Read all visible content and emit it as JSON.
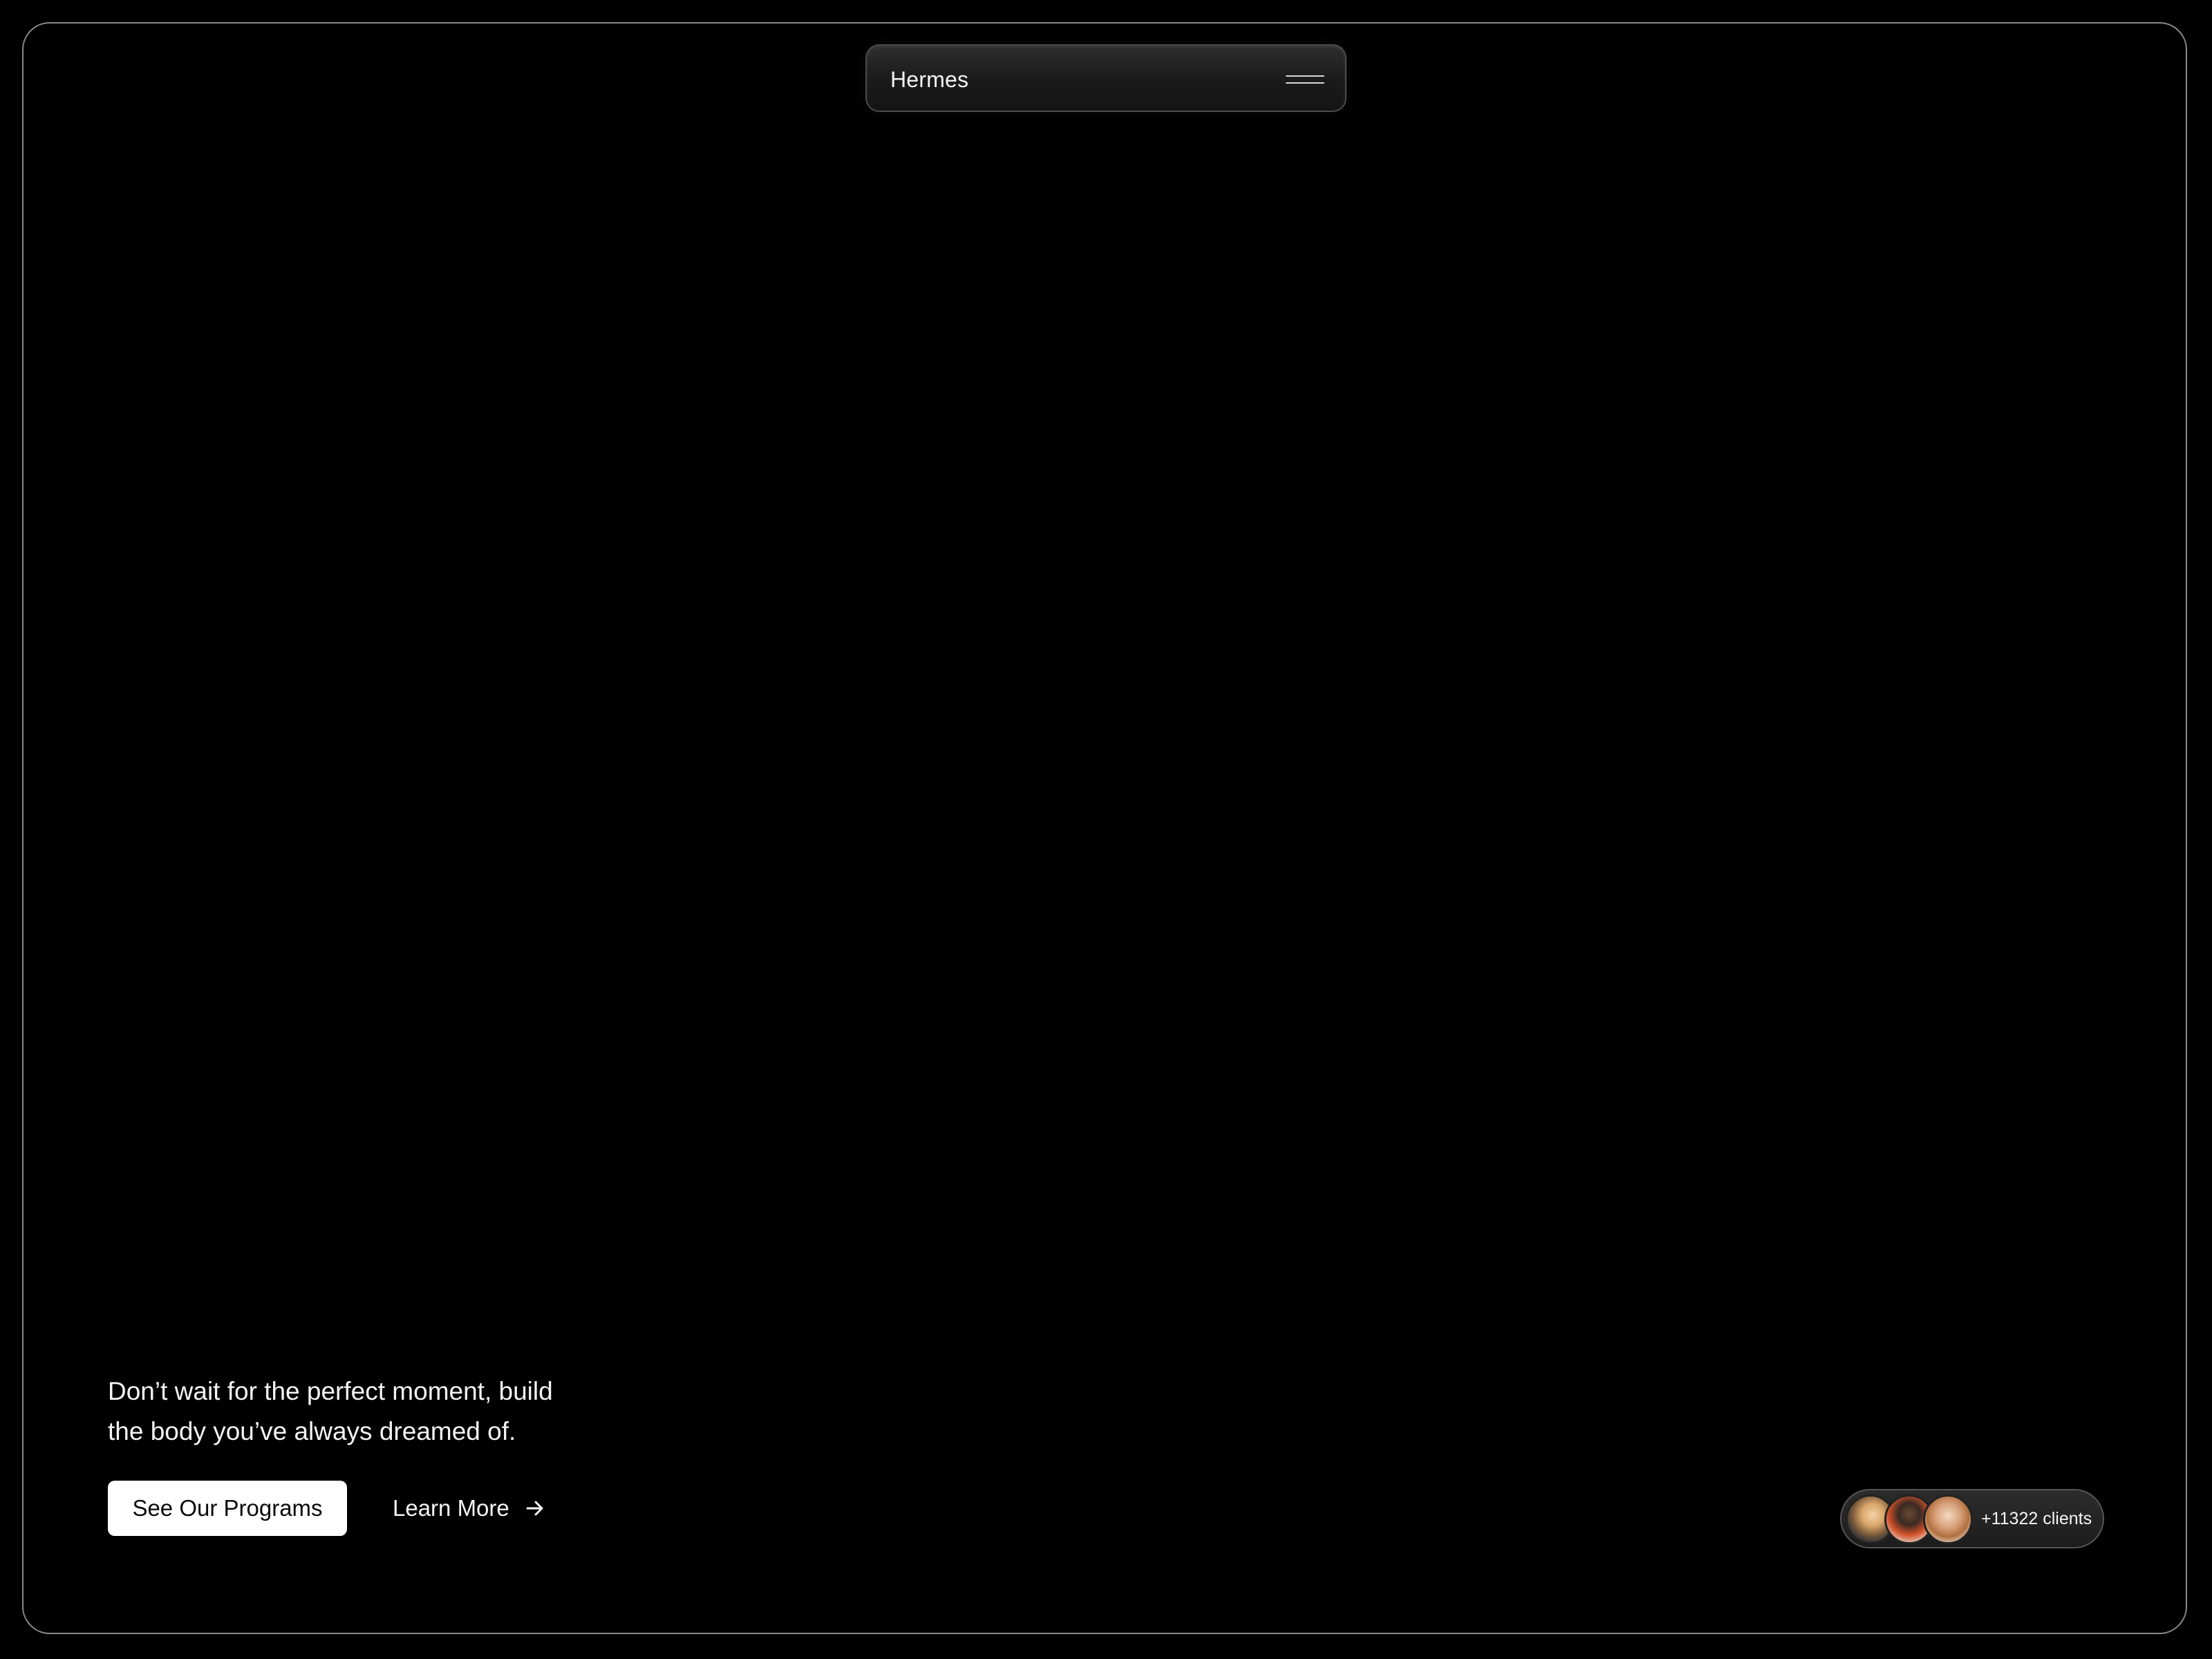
{
  "nav": {
    "brand": "Hermes",
    "menu_icon": "hamburger-menu-icon"
  },
  "hero": {
    "line1": "Don’t wait for the perfect moment, build",
    "line2": "the body you’ve always dreamed of.",
    "primary_button": "See Our Programs",
    "secondary_button": "Learn More",
    "secondary_icon": "arrow-right-icon"
  },
  "clients": {
    "label": "+11322 clients",
    "avatars": [
      "avatar",
      "avatar",
      "avatar"
    ]
  },
  "colors": {
    "background": "#000000",
    "frame_border": "#8a8a8a",
    "text": "#f4f4f4",
    "button_bg": "#ffffff",
    "button_text": "#0a0a0a"
  }
}
